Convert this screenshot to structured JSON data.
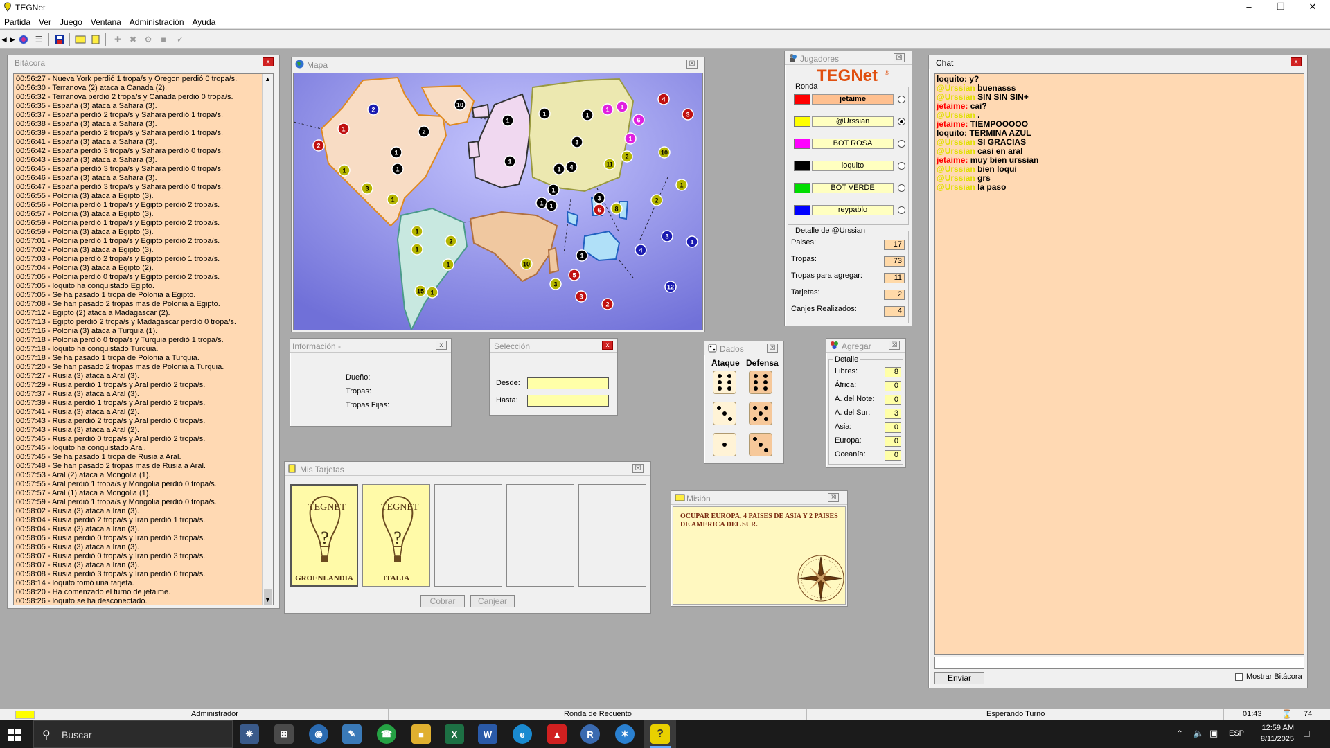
{
  "window": {
    "title": "TEGNet"
  },
  "menu": [
    "Partida",
    "Ver",
    "Juego",
    "Ventana",
    "Administración",
    "Ayuda"
  ],
  "toolbar_icons": [
    "connect-icon",
    "globe-icon",
    "list-icon",
    "save-icon",
    "card-icon",
    "note-icon",
    "add-icon",
    "remove-icon",
    "gear-icon",
    "stop-icon",
    "check-icon"
  ],
  "bitacora": {
    "title": "Bitácora",
    "lines": [
      "00:56:27 - Nueva York perdió 1 tropa/s y Oregon perdió 0 tropa/s.",
      "00:56:30 - Terranova (2) ataca a Canada (2).",
      "00:56:32 - Terranova perdió 2 tropa/s y Canada perdió 0 tropa/s.",
      "00:56:35 - España (3) ataca a Sahara (3).",
      "00:56:37 - España perdió 2 tropa/s y Sahara perdió 1 tropa/s.",
      "00:56:38 - España (3) ataca a Sahara (3).",
      "00:56:39 - España perdió 2 tropa/s y Sahara perdió 1 tropa/s.",
      "00:56:41 - España (3) ataca a Sahara (3).",
      "00:56:42 - España perdió 3 tropa/s y Sahara perdió 0 tropa/s.",
      "00:56:43 - España (3) ataca a Sahara (3).",
      "00:56:45 - España perdió 3 tropa/s y Sahara perdió 0 tropa/s.",
      "00:56:46 - España (3) ataca a Sahara (3).",
      "00:56:47 - España perdió 3 tropa/s y Sahara perdió 0 tropa/s.",
      "00:56:55 - Polonia (3) ataca a Egipto (3).",
      "00:56:56 - Polonia perdió 1 tropa/s y Egipto perdió 2 tropa/s.",
      "00:56:57 - Polonia (3) ataca a Egipto (3).",
      "00:56:59 - Polonia perdió 1 tropa/s y Egipto perdió 2 tropa/s.",
      "00:56:59 - Polonia (3) ataca a Egipto (3).",
      "00:57:01 - Polonia perdió 1 tropa/s y Egipto perdió 2 tropa/s.",
      "00:57:02 - Polonia (3) ataca a Egipto (3).",
      "00:57:03 - Polonia perdió 2 tropa/s y Egipto perdió 1 tropa/s.",
      "00:57:04 - Polonia (3) ataca a Egipto (2).",
      "00:57:05 - Polonia perdió 0 tropa/s y Egipto perdió 2 tropa/s.",
      "00:57:05 - loquito ha conquistado Egipto.",
      "00:57:05 - Se ha pasado 1 tropa de Polonia a Egipto.",
      "00:57:08 - Se han pasado 2 tropas mas de Polonia a Egipto.",
      "00:57:12 - Egipto (2) ataca a Madagascar (2).",
      "00:57:13 - Egipto perdió 2 tropa/s y Madagascar perdió 0 tropa/s.",
      "00:57:16 - Polonia (3) ataca a Turquia (1).",
      "00:57:18 - Polonia perdió 0 tropa/s y Turquia perdió 1 tropa/s.",
      "00:57:18 - loquito ha conquistado Turquia.",
      "00:57:18 - Se ha pasado 1 tropa de Polonia a Turquia.",
      "00:57:20 - Se han pasado 2 tropas mas de Polonia a Turquia.",
      "00:57:27 - Rusia (3) ataca a Aral (3).",
      "00:57:29 - Rusia perdió 1 tropa/s y Aral perdió 2 tropa/s.",
      "00:57:37 - Rusia (3) ataca a Aral (3).",
      "00:57:39 - Rusia perdió 1 tropa/s y Aral perdió 2 tropa/s.",
      "00:57:41 - Rusia (3) ataca a Aral (2).",
      "00:57:43 - Rusia perdió 2 tropa/s y Aral perdió 0 tropa/s.",
      "00:57:43 - Rusia (3) ataca a Aral (2).",
      "00:57:45 - Rusia perdió 0 tropa/s y Aral perdió 2 tropa/s.",
      "00:57:45 - loquito ha conquistado Aral.",
      "00:57:45 - Se ha pasado 1 tropa de Rusia a Aral.",
      "00:57:48 - Se han pasado 2 tropas mas de Rusia a Aral.",
      "00:57:53 - Aral (2) ataca a Mongolia (1).",
      "00:57:55 - Aral perdió 1 tropa/s y Mongolia perdió 0 tropa/s.",
      "00:57:57 - Aral (1) ataca a Mongolia (1).",
      "00:57:59 - Aral perdió 1 tropa/s y Mongolia perdió 0 tropa/s.",
      "00:58:02 - Rusia (3) ataca a Iran (3).",
      "00:58:04 - Rusia perdió 2 tropa/s y Iran perdió 1 tropa/s.",
      "00:58:04 - Rusia (3) ataca a Iran (3).",
      "00:58:05 - Rusia perdió 0 tropa/s y Iran perdió 3 tropa/s.",
      "00:58:05 - Rusia (3) ataca a Iran (3).",
      "00:58:07 - Rusia perdió 0 tropa/s y Iran perdió 3 tropa/s.",
      "00:58:07 - Rusia (3) ataca a Iran (3).",
      "00:58:08 - Rusia perdió 3 tropa/s y Iran perdió 0 tropa/s.",
      "00:58:14 - loquito tomó una tarjeta.",
      "00:58:20 - Ha comenzado el turno de jetaime.",
      "00:58:26 - loquito se ha desconectado."
    ]
  },
  "mapa": {
    "title": "Mapa",
    "bg_color": "#9090e0",
    "armies": [
      {
        "n": "2",
        "c": "#1a1ab0"
      },
      {
        "n": "10",
        "c": "#000000"
      },
      {
        "n": "1",
        "c": "#c01010"
      },
      {
        "n": "2",
        "c": "#c01010"
      },
      {
        "n": "2",
        "c": "#000000"
      },
      {
        "n": "1",
        "c": "#000000"
      },
      {
        "n": "1",
        "c": "#000000"
      },
      {
        "n": "1",
        "c": "#b5b500"
      },
      {
        "n": "3",
        "c": "#b5b500"
      },
      {
        "n": "1",
        "c": "#b5b500"
      },
      {
        "n": "1",
        "c": "#b5b500"
      },
      {
        "n": "2",
        "c": "#b5b500"
      },
      {
        "n": "1",
        "c": "#b5b500"
      },
      {
        "n": "1",
        "c": "#b5b500"
      },
      {
        "n": "15",
        "c": "#b5b500"
      },
      {
        "n": "1",
        "c": "#b5b500"
      },
      {
        "n": "1",
        "c": "#000000"
      },
      {
        "n": "1",
        "c": "#000000"
      },
      {
        "n": "1",
        "c": "#000000"
      },
      {
        "n": "1",
        "c": "#000000"
      },
      {
        "n": "3",
        "c": "#000000"
      },
      {
        "n": "1",
        "c": "#000000"
      },
      {
        "n": "1",
        "c": "#000000"
      },
      {
        "n": "4",
        "c": "#000000"
      },
      {
        "n": "1",
        "c": "#000000"
      },
      {
        "n": "1",
        "c": "#000000"
      },
      {
        "n": "3",
        "c": "#000000"
      },
      {
        "n": "1",
        "c": "#e020e0"
      },
      {
        "n": "1",
        "c": "#e020e0"
      },
      {
        "n": "6",
        "c": "#e020e0"
      },
      {
        "n": "1",
        "c": "#e020e0"
      },
      {
        "n": "4",
        "c": "#c01010"
      },
      {
        "n": "3",
        "c": "#c01010"
      },
      {
        "n": "10",
        "c": "#b5b500"
      },
      {
        "n": "2",
        "c": "#b5b500"
      },
      {
        "n": "11",
        "c": "#b5b500"
      },
      {
        "n": "1",
        "c": "#b5b500"
      },
      {
        "n": "2",
        "c": "#b5b500"
      },
      {
        "n": "8",
        "c": "#b5b500"
      },
      {
        "n": "6",
        "c": "#c01010"
      },
      {
        "n": "10",
        "c": "#b5b500"
      },
      {
        "n": "3",
        "c": "#b5b500"
      },
      {
        "n": "1",
        "c": "#000000"
      },
      {
        "n": "5",
        "c": "#c01010"
      },
      {
        "n": "3",
        "c": "#c01010"
      },
      {
        "n": "2",
        "c": "#c01010"
      },
      {
        "n": "4",
        "c": "#1a1ab0"
      },
      {
        "n": "3",
        "c": "#1a1ab0"
      },
      {
        "n": "1",
        "c": "#1a1ab0"
      },
      {
        "n": "12",
        "c": "#1a1ab0"
      }
    ]
  },
  "jugadores": {
    "title": "Jugadores",
    "logo": "TEGNet",
    "ronda_label": "Ronda",
    "players": [
      {
        "name": "jetaime",
        "color": "#ff0000",
        "active": true,
        "selected": false
      },
      {
        "name": "@Urssian",
        "color": "#ffff00",
        "active": false,
        "selected": true
      },
      {
        "name": "BOT ROSA",
        "color": "#ff00ff",
        "active": false,
        "selected": false
      },
      {
        "name": "loquito",
        "color": "#000000",
        "active": false,
        "selected": false
      },
      {
        "name": "BOT VERDE",
        "color": "#00dd00",
        "active": false,
        "selected": false
      },
      {
        "name": "reypablo",
        "color": "#0000ff",
        "active": false,
        "selected": false
      }
    ],
    "detalle_title": "Detalle de @Urssian",
    "stats": [
      {
        "label": "Paises:",
        "value": "17"
      },
      {
        "label": "Tropas:",
        "value": "73"
      },
      {
        "label": "Tropas para agregar:",
        "value": "11"
      },
      {
        "label": "Tarjetas:",
        "value": "2"
      },
      {
        "label": "Canjes Realizados:",
        "value": "4"
      }
    ]
  },
  "informacion": {
    "title": "Información -",
    "labels": [
      "Dueño:",
      "Tropas:",
      "Tropas Fijas:"
    ]
  },
  "seleccion": {
    "title": "Selección",
    "desde_label": "Desde:",
    "hasta_label": "Hasta:"
  },
  "dados": {
    "title": "Dados",
    "ataque_label": "Ataque",
    "defensa_label": "Defensa",
    "ataque": [
      6,
      3,
      1
    ],
    "defensa": [
      6,
      5,
      3
    ]
  },
  "agregar": {
    "title": "Agregar",
    "detalle_label": "Detalle",
    "rows": [
      {
        "label": "Libres:",
        "value": "8"
      },
      {
        "label": "África:",
        "value": "0"
      },
      {
        "label": "A. del Note:",
        "value": "0"
      },
      {
        "label": "A. del Sur:",
        "value": "3"
      },
      {
        "label": "Asia:",
        "value": "0"
      },
      {
        "label": "Europa:",
        "value": "0"
      },
      {
        "label": "Oceanía:",
        "value": "0"
      }
    ]
  },
  "tarjetas": {
    "title": "Mis Tarjetas",
    "cards": [
      {
        "logo": "TEGNET",
        "name": "GROENLANDIA"
      },
      {
        "logo": "TEGNET",
        "name": "ITALIA"
      }
    ],
    "cobrar_label": "Cobrar",
    "canjear_label": "Canjear"
  },
  "mision": {
    "title": "Misión",
    "text": "OCUPAR EUROPA, 4 PAISES DE ASIA Y 2 PAISES DE AMERICA DEL SUR."
  },
  "chat": {
    "title": "Chat",
    "messages": [
      {
        "user": "loquito:",
        "text": "y?",
        "color": "#000000"
      },
      {
        "user": "@Urssian",
        "text": "buenasss",
        "color": "#e0e000"
      },
      {
        "user": "@Urssian",
        "text": "SIN SIN SIN+",
        "color": "#e0e000"
      },
      {
        "user": "jetaime:",
        "text": "cai?",
        "color": "#ff0000"
      },
      {
        "user": "@Urssian",
        "text": ".",
        "color": "#e0e000"
      },
      {
        "user": "jetaime:",
        "text": "TIEMPOOOOO",
        "color": "#ff0000"
      },
      {
        "user": "loquito:",
        "text": "TERMINA AZUL",
        "color": "#000000"
      },
      {
        "user": "@Urssian",
        "text": "SI GRACIAS",
        "color": "#e0e000"
      },
      {
        "user": "@Urssian",
        "text": "casi en aral",
        "color": "#e0e000"
      },
      {
        "user": "jetaime:",
        "text": "muy bien urssian",
        "color": "#ff0000"
      },
      {
        "user": "@Urssian",
        "text": "bien loqui",
        "color": "#e0e000"
      },
      {
        "user": "@Urssian",
        "text": "grs",
        "color": "#e0e000"
      },
      {
        "user": "@Urssian",
        "text": "la paso",
        "color": "#e0e000"
      }
    ],
    "send_label": "Enviar",
    "show_log_label": "Mostrar Bitácora"
  },
  "status": {
    "user": "Administrador",
    "phase": "Ronda de Recuento",
    "state": "Esperando Turno",
    "timer": "01:43",
    "count": "74"
  },
  "taskbar": {
    "search_placeholder": "Buscar",
    "lang": "ESP",
    "time": "12:59 AM",
    "date": "8/11/2025"
  }
}
